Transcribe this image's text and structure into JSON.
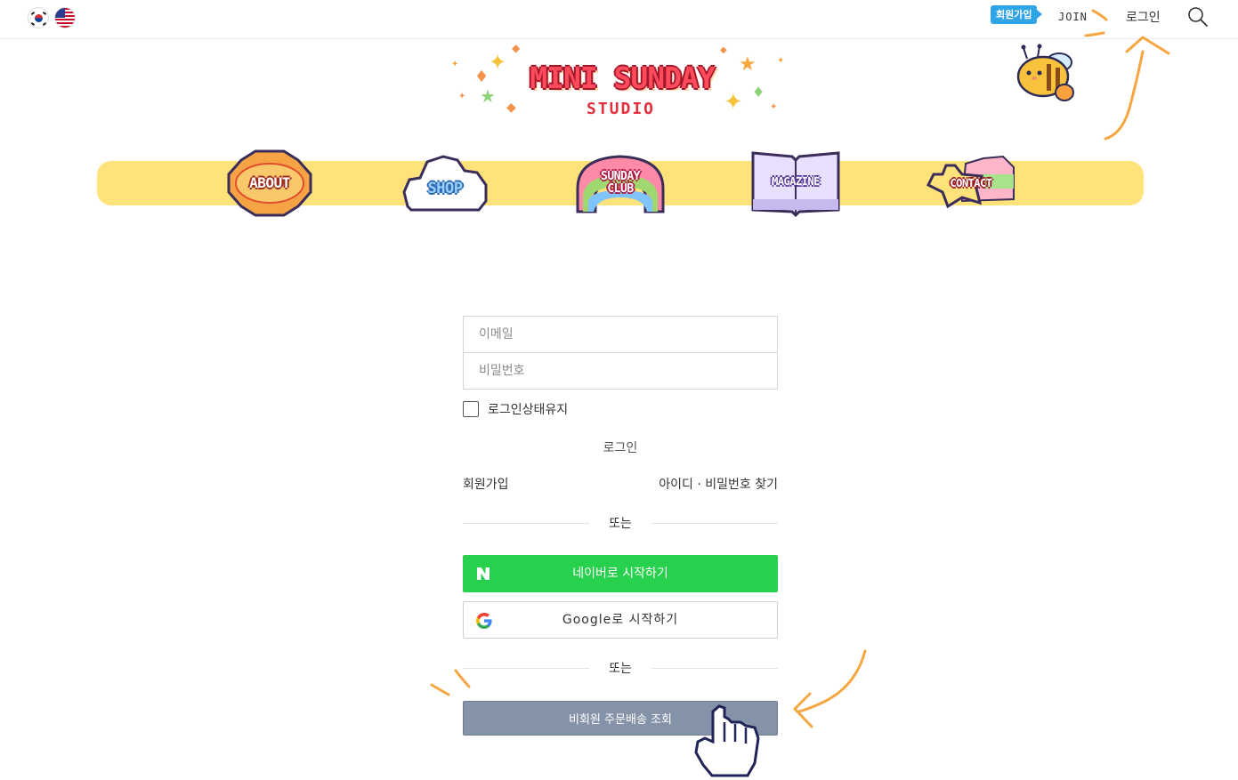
{
  "header": {
    "flags": [
      {
        "icon": "korea-flag-icon"
      },
      {
        "icon": "usa-flag-icon"
      }
    ],
    "join_badge": "회원가입",
    "join_text": "JOIN",
    "login_label": "로그인",
    "search_icon": "search-icon"
  },
  "logo": {
    "title": "MINI SUNDAY",
    "subtitle": "STUDIO"
  },
  "nav": {
    "items": [
      {
        "label": "ABOUT"
      },
      {
        "label": "SHOP"
      },
      {
        "label": "SUNDAY CLUB",
        "line1": "SUNDAY",
        "line2": "CLUB"
      },
      {
        "label": "MAGAZINE"
      },
      {
        "label": "CONTACT"
      }
    ]
  },
  "form": {
    "email_placeholder": "이메일",
    "password_placeholder": "비밀번호",
    "keep_login_label": "로그인상태유지",
    "keep_login_checked": false,
    "login_button": "로그인",
    "signup_link": "회원가입",
    "find_link": "아이디 · 비밀번호 찾기",
    "divider_1": "또는",
    "naver_button": "네이버로 시작하기",
    "google_button": "Google로 시작하기",
    "divider_2": "또는",
    "guest_order_button": "비회원 주문배송 조회"
  },
  "colors": {
    "nav_bar": "#ffe27a",
    "naver_green": "#28d14d",
    "guest_button": "#8593a8",
    "join_badge": "#2fa5e8",
    "annotation": "#f5a742"
  }
}
